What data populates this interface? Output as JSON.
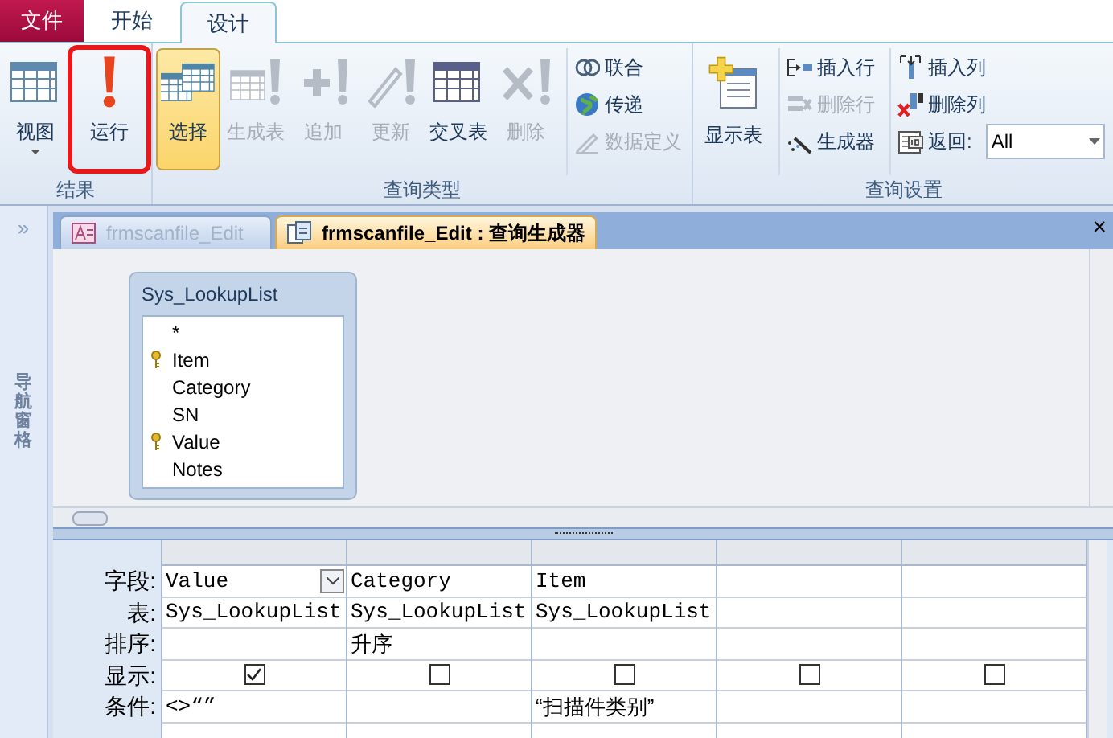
{
  "ribbon_tabs": [
    {
      "label": "文件",
      "kind": "file",
      "selected": false
    },
    {
      "label": "开始",
      "kind": "tab",
      "selected": false
    },
    {
      "label": "设计",
      "kind": "tab",
      "selected": true
    }
  ],
  "ribbon_groups": [
    {
      "label": "结果",
      "large_buttons": [
        {
          "label": "视图",
          "kind": "view",
          "disabled": false,
          "selected": false,
          "dropdown": true,
          "highlighted": false
        },
        {
          "label": "运行",
          "kind": "run",
          "disabled": false,
          "selected": false,
          "highlighted": true
        }
      ]
    },
    {
      "label": "查询类型",
      "large_buttons": [
        {
          "label": "选择",
          "kind": "select",
          "disabled": false,
          "selected": true,
          "highlighted": false
        },
        {
          "label": "生成表",
          "kind": "maketable",
          "disabled": true,
          "selected": false,
          "highlighted": false
        },
        {
          "label": "追加",
          "kind": "append",
          "disabled": true,
          "selected": false,
          "highlighted": false
        },
        {
          "label": "更新",
          "kind": "update",
          "disabled": true,
          "selected": false,
          "highlighted": false
        },
        {
          "label": "交叉表",
          "kind": "crosstab",
          "disabled": false,
          "selected": false,
          "highlighted": false
        },
        {
          "label": "删除",
          "kind": "delete",
          "disabled": true,
          "selected": false,
          "highlighted": false
        }
      ],
      "small_columns": [
        [
          {
            "label": "联合",
            "kind": "union",
            "disabled": false
          },
          {
            "label": "传递",
            "kind": "globe",
            "disabled": false
          },
          {
            "label": "数据定义",
            "kind": "pencil",
            "disabled": true
          }
        ]
      ]
    },
    {
      "label": "查询设置",
      "large_buttons": [
        {
          "label": "显示表",
          "kind": "showtable",
          "disabled": false,
          "selected": false,
          "highlighted": false
        }
      ],
      "small_columns": [
        [
          {
            "label": "插入行",
            "kind": "insertrow",
            "disabled": false
          },
          {
            "label": "删除行",
            "kind": "deleterow",
            "disabled": true
          },
          {
            "label": "生成器",
            "kind": "builder",
            "disabled": false
          }
        ],
        [
          {
            "label": "插入列",
            "kind": "insertcol",
            "disabled": false
          },
          {
            "label": "删除列",
            "kind": "deletecol",
            "disabled": false
          },
          {
            "label": "返回:",
            "kind": "return",
            "disabled": false,
            "combo": "All"
          }
        ]
      ]
    }
  ],
  "nav_pane": {
    "expand": "»",
    "label": "导航窗格"
  },
  "doc_tabs": [
    {
      "label": "frmscanfile_Edit",
      "kind": "form",
      "selected": false
    },
    {
      "label": "frmscanfile_Edit : 查询生成器",
      "kind": "query",
      "selected": true
    }
  ],
  "close": "×",
  "table_box": {
    "title": "Sys_LookupList",
    "fields": [
      {
        "name": "*",
        "key": false
      },
      {
        "name": "Item",
        "key": true
      },
      {
        "name": "Category",
        "key": false
      },
      {
        "name": "SN",
        "key": false
      },
      {
        "name": "Value",
        "key": true
      },
      {
        "name": "Notes",
        "key": false
      }
    ]
  },
  "grid": {
    "row_labels": [
      "字段:",
      "表:",
      "排序:",
      "显示:",
      "条件:"
    ],
    "columns": [
      {
        "field": "Value",
        "table": "Sys_LookupList",
        "show": true,
        "criteria": "<>“”",
        "selected": true
      },
      {
        "field": "Category",
        "table": "Sys_LookupList",
        "sort": "升序",
        "show": false,
        "selected": false
      },
      {
        "field": "Item",
        "table": "Sys_LookupList",
        "show": false,
        "criteria": "“扫描件类别”",
        "selected": false
      },
      {
        "show": false,
        "selected": false
      },
      {
        "show": false,
        "selected": false
      }
    ]
  }
}
